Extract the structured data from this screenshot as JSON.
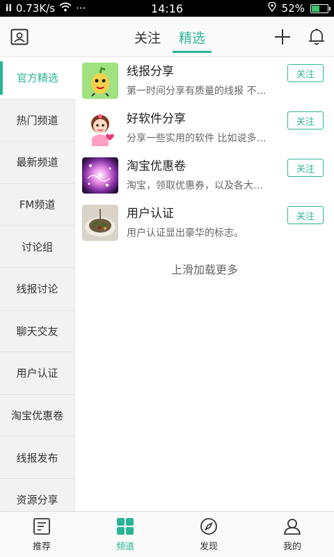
{
  "status_bar": {
    "signal": "il",
    "speed": "0.73K/s",
    "more": "···",
    "time": "14:16",
    "battery_percent": "52%",
    "battery_level": 0.52
  },
  "header": {
    "tabs": [
      {
        "label": "关注",
        "active": false
      },
      {
        "label": "精选",
        "active": true
      }
    ],
    "left_icon": "profile-card-icon",
    "right_icons": [
      "plus-icon",
      "bell-icon"
    ]
  },
  "sidebar": {
    "items": [
      {
        "label": "官方精选",
        "active": true
      },
      {
        "label": "热门频道"
      },
      {
        "label": "最新频道"
      },
      {
        "label": "FM频道"
      },
      {
        "label": "讨论组"
      },
      {
        "label": "线报讨论"
      },
      {
        "label": "聊天交友"
      },
      {
        "label": "用户认证"
      },
      {
        "label": "淘宝优惠卷"
      },
      {
        "label": "线报发布"
      },
      {
        "label": "资源分享"
      }
    ]
  },
  "channels": [
    {
      "title": "线报分享",
      "desc": "第一时间分享有质量的线报 不…",
      "follow": "关注"
    },
    {
      "title": "好软件分享",
      "desc": "分享一些实用的软件 比如说多…",
      "follow": "关注"
    },
    {
      "title": "淘宝优惠卷",
      "desc": "淘宝，领取优惠券，以及各大…",
      "follow": "关注"
    },
    {
      "title": "用户认证",
      "desc": "用户认证显出豪华的标志。",
      "follow": "关注"
    }
  ],
  "load_more": "上滑加载更多",
  "bottom_nav": [
    {
      "label": "推荐",
      "icon": "recommend-icon",
      "active": false
    },
    {
      "label": "频道",
      "icon": "channels-grid-icon",
      "active": true
    },
    {
      "label": "发现",
      "icon": "compass-icon",
      "active": false
    },
    {
      "label": "我的",
      "icon": "person-icon",
      "active": false
    }
  ],
  "colors": {
    "accent": "#2bb597",
    "sidebar_bg": "#f2f2f2",
    "battery_fill": "#39c36b"
  }
}
